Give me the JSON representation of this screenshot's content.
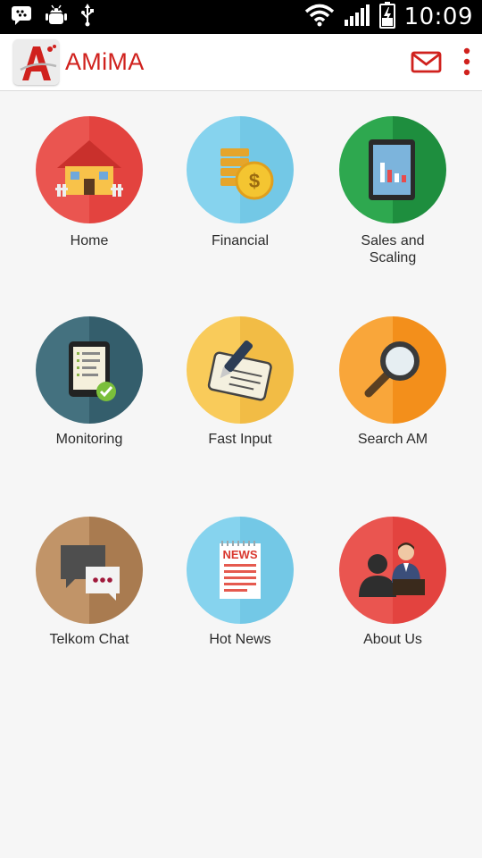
{
  "status_bar": {
    "time": "10:09",
    "icons": [
      "bbm-icon",
      "android-debug-icon",
      "usb-icon",
      "wifi-icon",
      "signal-icon",
      "battery-charging-icon"
    ]
  },
  "app_bar": {
    "title": "AMiMA",
    "logo_letter": "A",
    "actions": [
      "mail-icon",
      "overflow-menu-icon"
    ]
  },
  "menu": {
    "items": [
      {
        "label": "Home",
        "icon": "home-icon",
        "color": "#e94f4a"
      },
      {
        "label": "Financial",
        "icon": "financial-icon",
        "color": "#7ccde8"
      },
      {
        "label": "Sales and Scaling",
        "icon": "sales-scaling-icon",
        "color": "#239a45"
      },
      {
        "label": "Monitoring",
        "icon": "monitoring-icon",
        "color": "#3e6b7a"
      },
      {
        "label": "Fast Input",
        "icon": "fast-input-icon",
        "color": "#f6c04e"
      },
      {
        "label": "Search AM",
        "icon": "search-am-icon",
        "color": "#f79b23"
      },
      {
        "label": "Telkom Chat",
        "icon": "telkom-chat-icon",
        "color": "#b48557"
      },
      {
        "label": "Hot News",
        "icon": "hot-news-icon",
        "color": "#7ccde8"
      },
      {
        "label": "About Us",
        "icon": "about-us-icon",
        "color": "#e94f4a"
      }
    ]
  },
  "colors": {
    "brand": "#d0211d",
    "status_bar": "#000000",
    "background": "#f6f6f6"
  }
}
